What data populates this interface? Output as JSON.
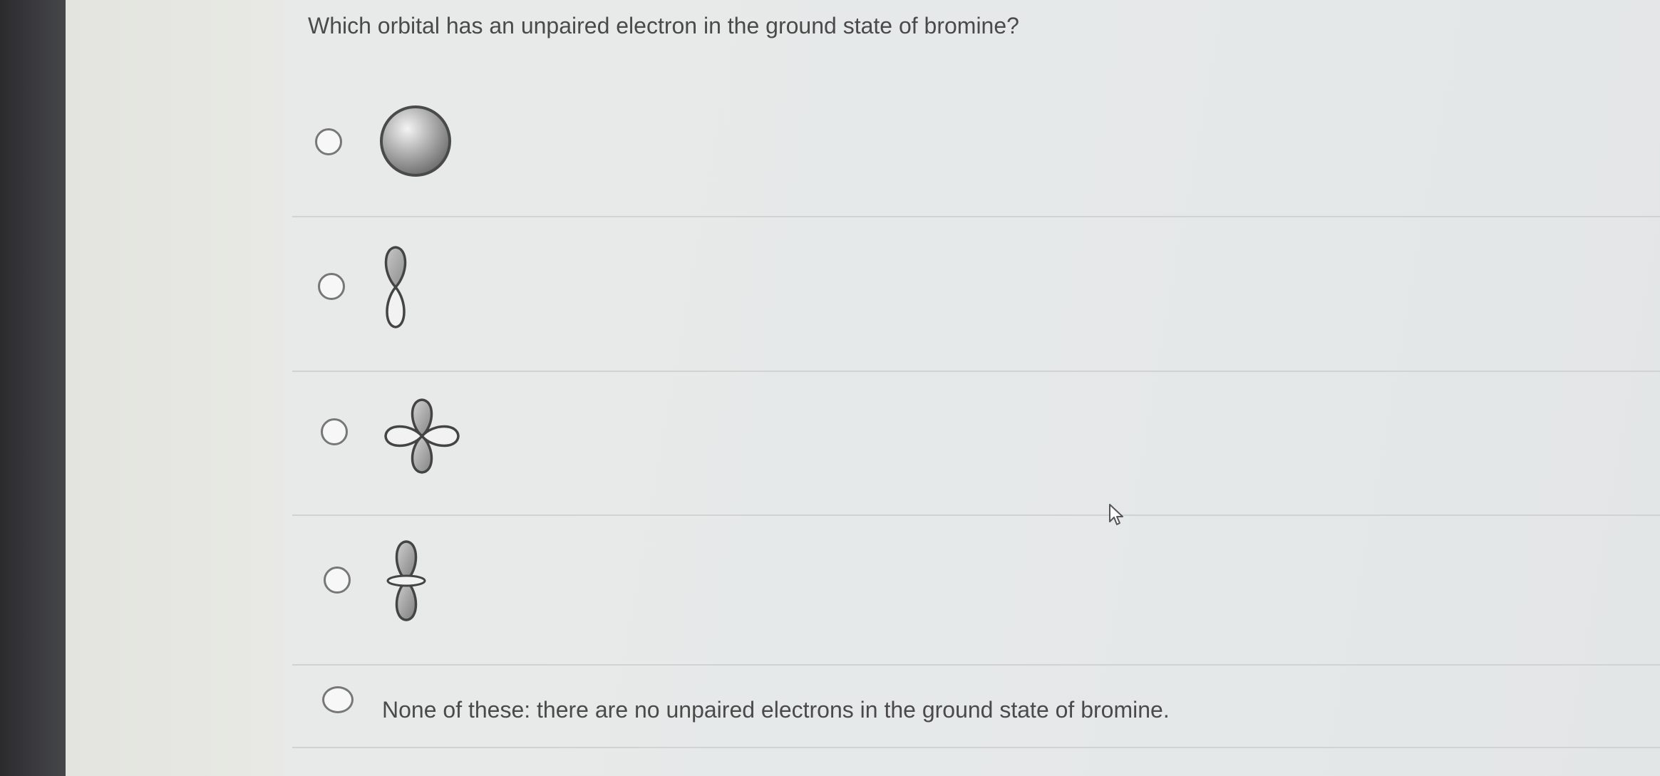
{
  "question": {
    "text": "Which orbital has an unpaired electron in the ground state of bromine?"
  },
  "options": [
    {
      "id": "a",
      "icon": "s-orbital-sphere-icon",
      "label": ""
    },
    {
      "id": "b",
      "icon": "p-orbital-outline-icon",
      "label": ""
    },
    {
      "id": "c",
      "icon": "d-orbital-cloverleaf-icon",
      "label": ""
    },
    {
      "id": "d",
      "icon": "dz2-orbital-icon",
      "label": ""
    },
    {
      "id": "e",
      "icon": "",
      "label": "None of these: there are no unpaired electrons in the ground state of bromine."
    }
  ],
  "colors": {
    "text": "#4a4a4a",
    "radio_border": "#777777",
    "orbital_fill": "#9a9a9a",
    "divider": "#d0d3d2"
  }
}
